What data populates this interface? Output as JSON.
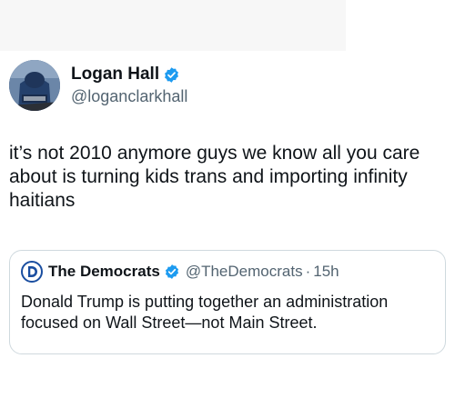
{
  "post": {
    "author": {
      "display_name": "Logan Hall",
      "handle": "@loganclarkhall",
      "verified_icon": "verified-badge-icon",
      "avatar_icon": "profile-photo"
    },
    "text": "it’s not 2010 anymore guys we know all you care about is turning kids trans and importing infinity haitians"
  },
  "quoted_post": {
    "author": {
      "display_name": "The Democrats",
      "handle": "@TheDemocrats",
      "verified_icon": "verified-badge-icon",
      "avatar_icon": "democrats-logo-icon"
    },
    "separator": "·",
    "time": "15h",
    "text": "Donald Trump is putting together an administration focused on Wall Street—not Main Street."
  },
  "colors": {
    "verified_blue": "#1d9bf0",
    "democrats_blue": "#1a4ea0",
    "secondary_text": "#536471",
    "border": "#cfd9de"
  }
}
